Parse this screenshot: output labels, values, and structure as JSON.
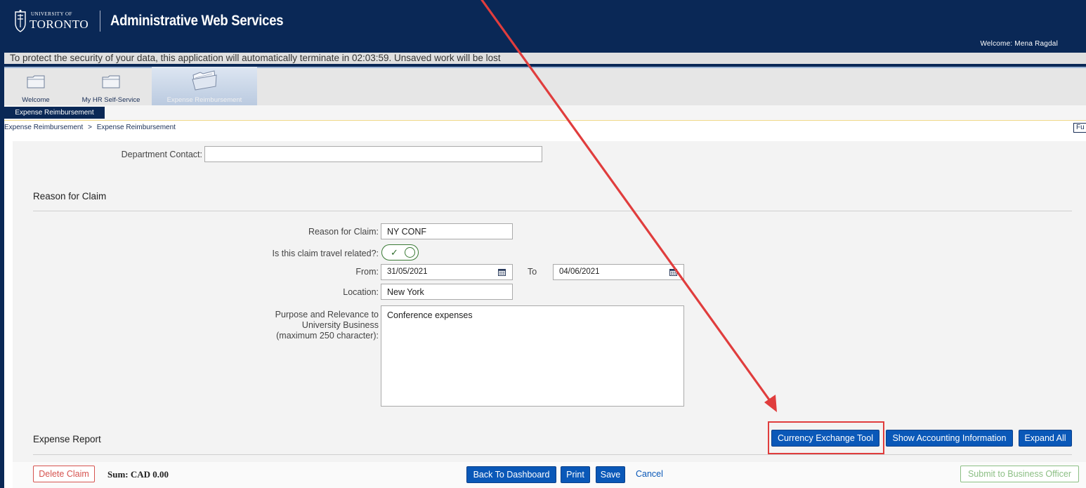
{
  "header": {
    "university_small": "UNIVERSITY OF",
    "university_big": "TORONTO",
    "app_title": "Administrative Web Services",
    "welcome": "Welcome: Mena Ragdal"
  },
  "timeout_message": "To protect the security of your data, this application will automatically terminate in 02:03:59. Unsaved work will be lost",
  "tabs": [
    {
      "label": "Welcome"
    },
    {
      "label": "My HR Self-Service"
    },
    {
      "label": "Expense Reimbursement"
    }
  ],
  "sub_tab": "Expense Reimbursement",
  "breadcrumb": [
    "Expense Reimbursement",
    ">",
    "Expense Reimbursement"
  ],
  "fu_tab": "Fu",
  "form": {
    "department_contact_label": "Department Contact:",
    "department_contact_value": "",
    "section_reason": "Reason for Claim",
    "reason_label": "Reason for Claim:",
    "reason_value": "NY CONF",
    "travel_label": "Is this claim travel related?:",
    "travel_check": "✓",
    "from_label": "From:",
    "from_value": "31/05/2021",
    "to_label": "To",
    "to_value": "04/06/2021",
    "location_label": "Location:",
    "location_value": "New York",
    "purpose_label_1": "Purpose and Relevance to",
    "purpose_label_2": "University Business",
    "purpose_label_3": "(maximum 250 character):",
    "purpose_value": "Conference expenses",
    "section_expense": "Expense Report"
  },
  "buttons": {
    "currency": "Currency Exchange Tool",
    "show_accounting": "Show Accounting Information",
    "expand_all": "Expand All",
    "delete_claim": "Delete Claim",
    "back_dashboard": "Back To Dashboard",
    "print": "Print",
    "save": "Save",
    "cancel": "Cancel",
    "submit": "Submit to Business Officer"
  },
  "sum": "Sum: CAD  0.00",
  "colors": {
    "header_navy": "#0a2856",
    "button_blue": "#0a58b8",
    "annotation_red": "#e03d3d"
  }
}
